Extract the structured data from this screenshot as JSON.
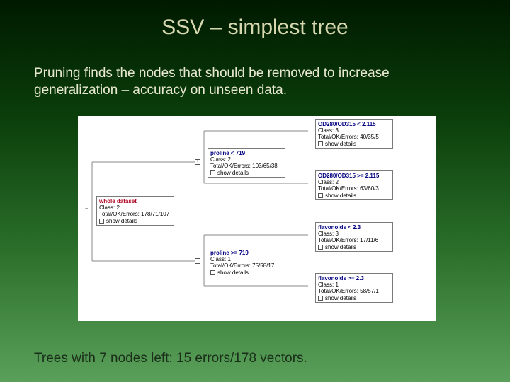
{
  "slide": {
    "title": "SSV – simplest tree",
    "subtitle": "Pruning finds the nodes that should be removed to increase generalization – accuracy on unseen data.",
    "bottom": "Trees with 7 nodes left: 15 errors/178 vectors."
  },
  "tree": {
    "root": {
      "header": "whole dataset",
      "l2": "Class: 2",
      "l3": "Total/OK/Errors: 178/71/107",
      "cb": "show details"
    },
    "n1": {
      "header": "proline < 719",
      "l2": "Class: 2",
      "l3": "Total/OK/Errors: 103/65/38",
      "cb": "show details"
    },
    "n2": {
      "header": "proline >= 719",
      "l2": "Class: 1",
      "l3": "Total/OK/Errors: 75/58/17",
      "cb": "show details"
    },
    "n3": {
      "header": "OD280/OD315 < 2.115",
      "l2": "Class: 3",
      "l3": "Total/OK/Errors: 40/35/5",
      "cb": "show details"
    },
    "n4": {
      "header": "OD280/OD315 >= 2.115",
      "l2": "Class: 2",
      "l3": "Total/OK/Errors: 63/60/3",
      "cb": "show details"
    },
    "n5": {
      "header": "flavonoids < 2.3",
      "l2": "Class: 3",
      "l3": "Total/OK/Errors: 17/11/6",
      "cb": "show details"
    },
    "n6": {
      "header": "flavonoids >= 2.3",
      "l2": "Class: 1",
      "l3": "Total/OK/Errors: 58/57/1",
      "cb": "show details"
    }
  }
}
